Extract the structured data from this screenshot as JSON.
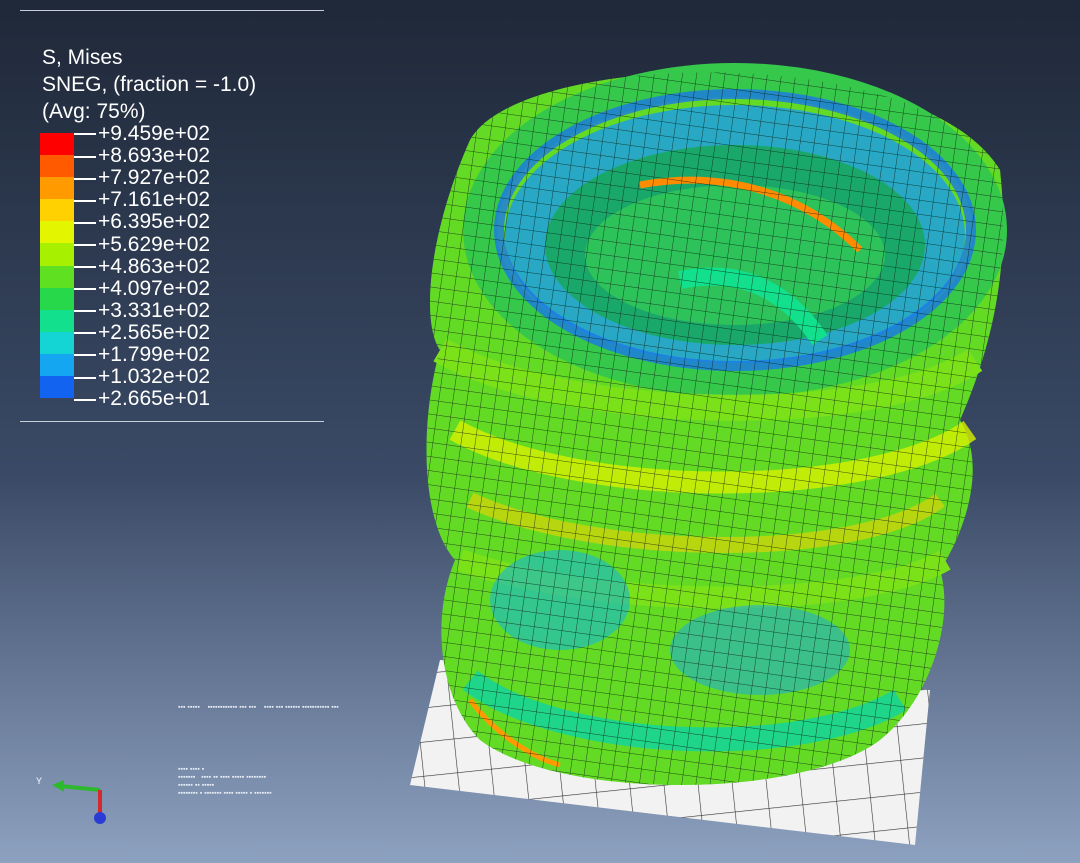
{
  "legend": {
    "title": "S, Mises",
    "line2": "SNEG, (fraction = -1.0)",
    "line3": "(Avg: 75%)",
    "levels": [
      {
        "label": "+9.459e+02",
        "color": "#ff0000"
      },
      {
        "label": "+8.693e+02",
        "color": "#ff5a00"
      },
      {
        "label": "+7.927e+02",
        "color": "#ff9b00"
      },
      {
        "label": "+7.161e+02",
        "color": "#ffd100"
      },
      {
        "label": "+6.395e+02",
        "color": "#e4f500"
      },
      {
        "label": "+5.629e+02",
        "color": "#a6f000"
      },
      {
        "label": "+4.863e+02",
        "color": "#5fe020"
      },
      {
        "label": "+4.097e+02",
        "color": "#27d94a"
      },
      {
        "label": "+3.331e+02",
        "color": "#12e08c"
      },
      {
        "label": "+2.565e+02",
        "color": "#14d4d4"
      },
      {
        "label": "+1.799e+02",
        "color": "#14a6f0"
      },
      {
        "label": "+1.032e+02",
        "color": "#1264f0"
      },
      {
        "label": "+2.665e+01",
        "color": "#1414ff"
      }
    ]
  },
  "triad": {
    "axis_label": "Y",
    "x_color": "#2eb82e",
    "y_color": "#d42a2a",
    "z_color": "#2a3cd4"
  },
  "colors": {
    "mesh_line": "#0b1a10",
    "floor": "#f2f2f2"
  }
}
